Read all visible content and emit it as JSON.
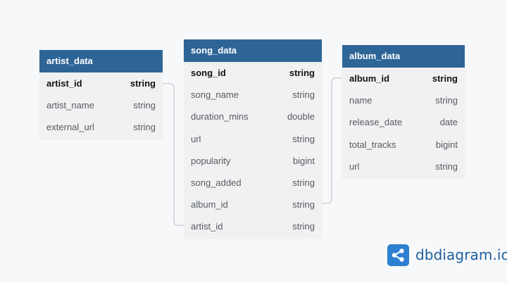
{
  "colors": {
    "header": "#2e6597",
    "background": "#f7f8fa",
    "table_body": "#f1f1f2",
    "connector": "#c9cbcf",
    "brand": "#2d7fd0"
  },
  "tables": {
    "artist_data": {
      "name": "artist_data",
      "columns": [
        {
          "name": "artist_id",
          "type": "string",
          "pk": true
        },
        {
          "name": "artist_name",
          "type": "string",
          "pk": false
        },
        {
          "name": "external_url",
          "type": "string",
          "pk": false
        }
      ]
    },
    "song_data": {
      "name": "song_data",
      "columns": [
        {
          "name": "song_id",
          "type": "string",
          "pk": true
        },
        {
          "name": "song_name",
          "type": "string",
          "pk": false
        },
        {
          "name": "duration_mins",
          "type": "double",
          "pk": false
        },
        {
          "name": "url",
          "type": "string",
          "pk": false
        },
        {
          "name": "popularity",
          "type": "bigint",
          "pk": false
        },
        {
          "name": "song_added",
          "type": "string",
          "pk": false
        },
        {
          "name": "album_id",
          "type": "string",
          "pk": false
        },
        {
          "name": "artist_id",
          "type": "string",
          "pk": false
        }
      ]
    },
    "album_data": {
      "name": "album_data",
      "columns": [
        {
          "name": "album_id",
          "type": "string",
          "pk": true
        },
        {
          "name": "name",
          "type": "string",
          "pk": false
        },
        {
          "name": "release_date",
          "type": "date",
          "pk": false
        },
        {
          "name": "total_tracks",
          "type": "bigint",
          "pk": false
        },
        {
          "name": "url",
          "type": "string",
          "pk": false
        }
      ]
    }
  },
  "relationships": [
    {
      "from": "song_data.artist_id",
      "to": "artist_data.artist_id"
    },
    {
      "from": "song_data.album_id",
      "to": "album_data.album_id"
    }
  ],
  "brand": {
    "name": "dbdiagram.io",
    "icon": "share-graph-icon"
  }
}
